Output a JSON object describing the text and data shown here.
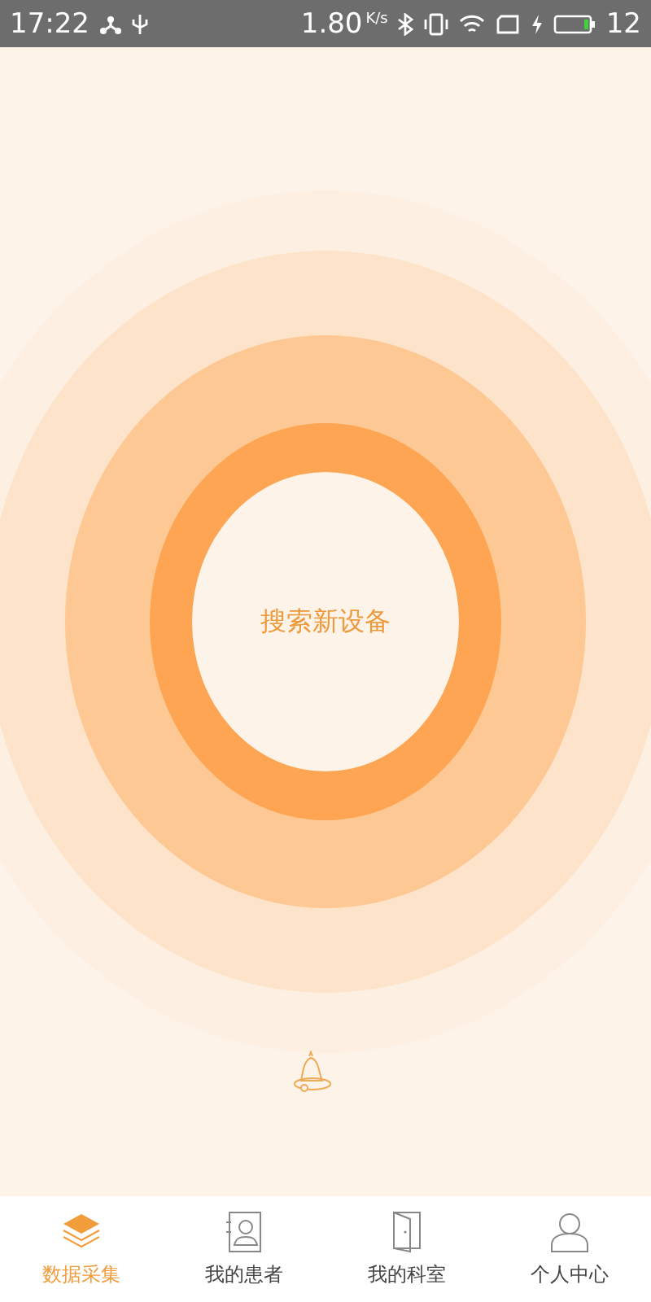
{
  "status_bar": {
    "time": "17:22",
    "speed": "1.80",
    "speed_unit": "K/s",
    "battery": "12"
  },
  "search_button": {
    "label": "搜索新设备"
  },
  "tabs": [
    {
      "label": "数据采集",
      "kind": "layers",
      "selected": true
    },
    {
      "label": "我的患者",
      "kind": "contacts",
      "selected": false
    },
    {
      "label": "我的科室",
      "kind": "door",
      "selected": false
    },
    {
      "label": "个人中心",
      "kind": "person",
      "selected": false
    }
  ]
}
